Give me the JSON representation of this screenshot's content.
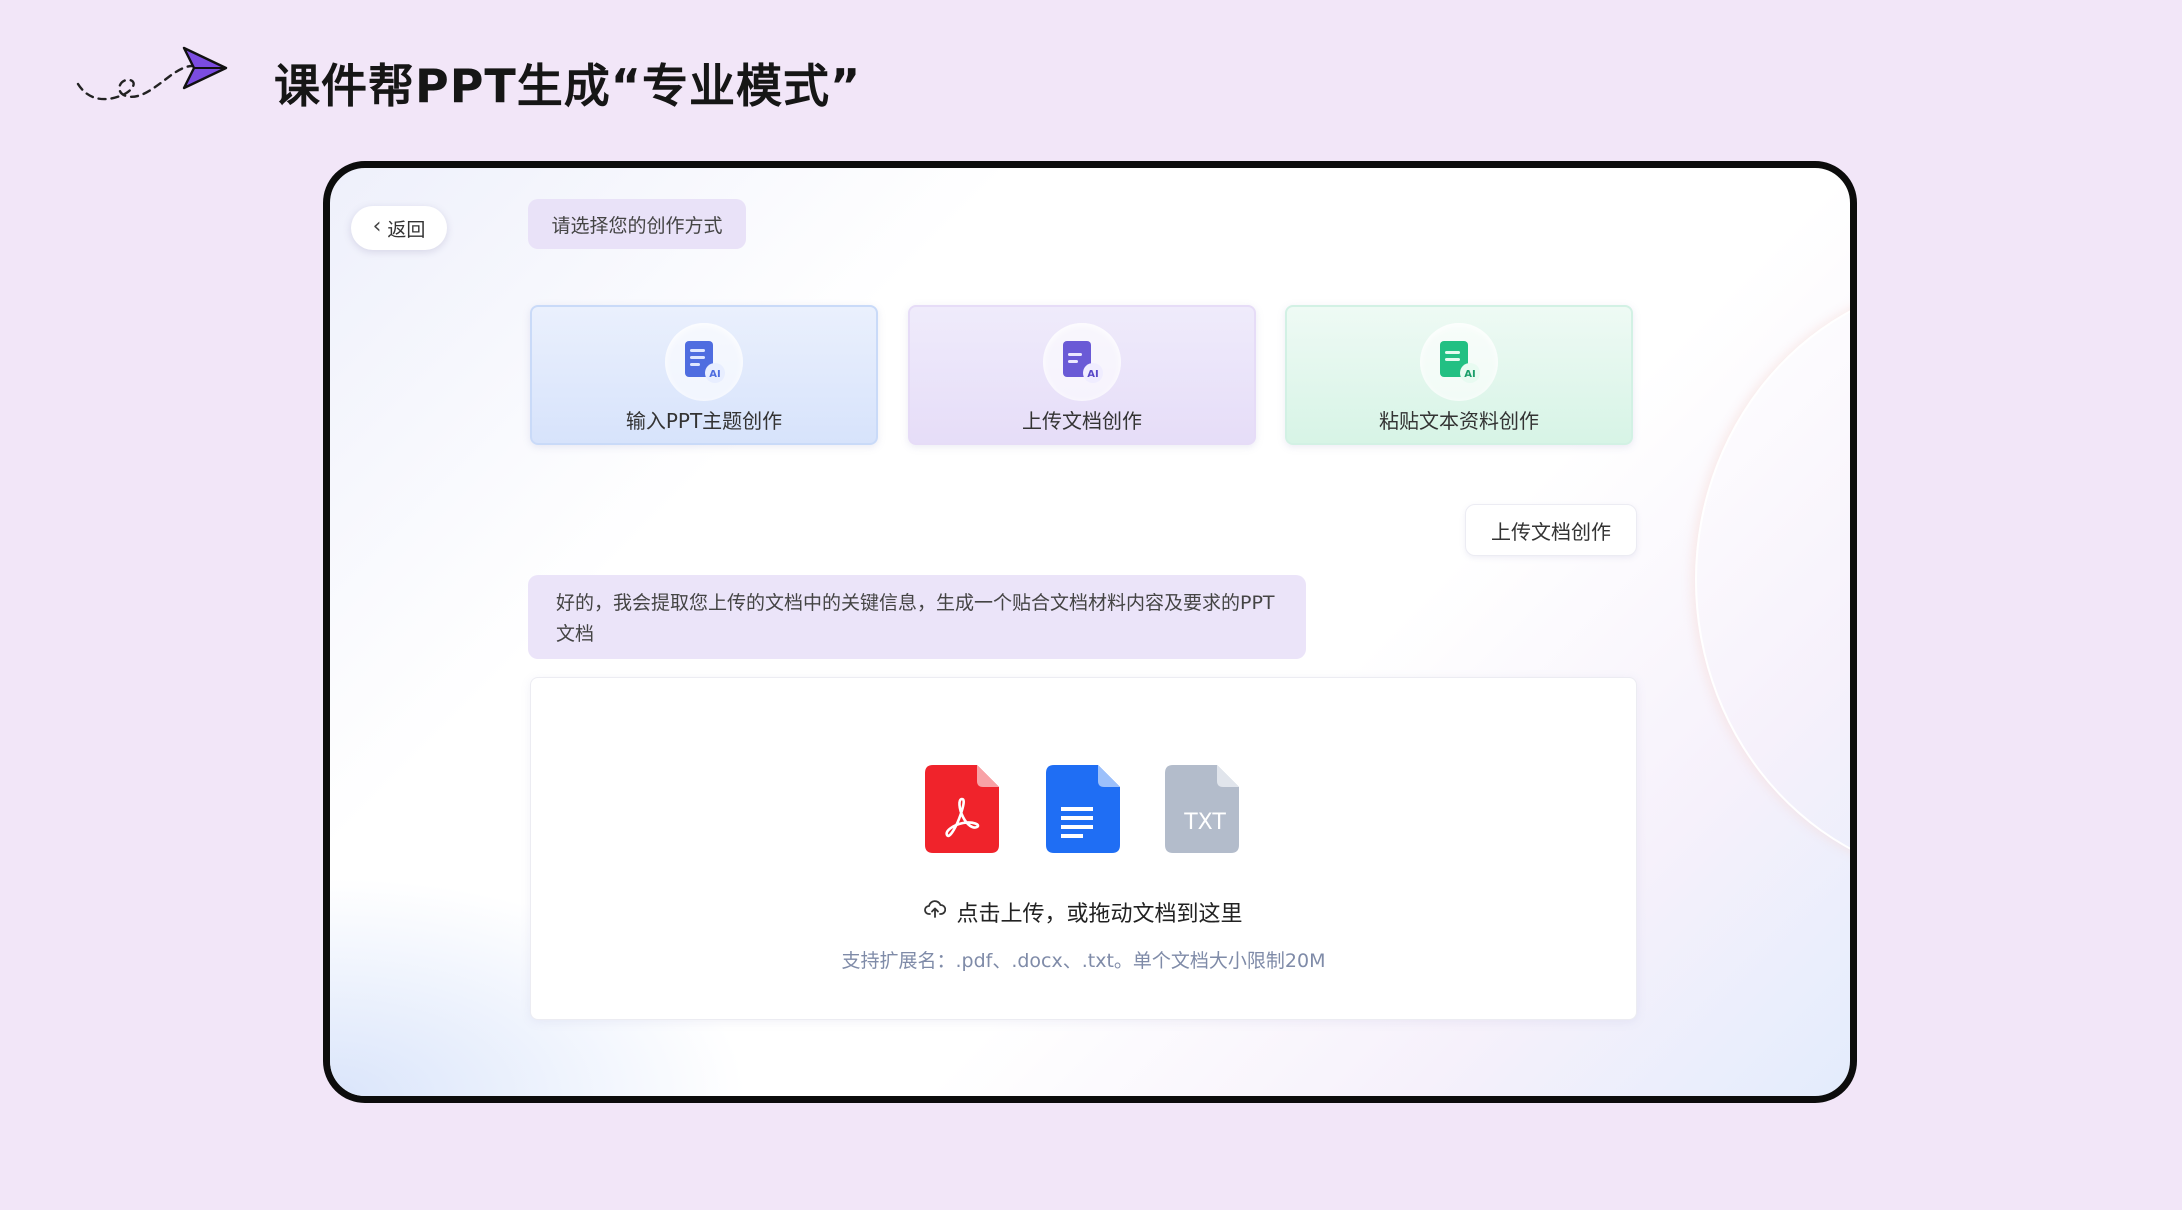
{
  "page_title": "课件帮PPT生成“专业模式”",
  "app": {
    "back_label": "返回",
    "prompt": "请选择您的创作方式",
    "modes": [
      {
        "label": "输入PPT主题创作",
        "icon": "topic-doc-icon",
        "color": "#4f6de0"
      },
      {
        "label": "上传文档创作",
        "icon": "upload-doc-icon",
        "color": "#6a5ad6"
      },
      {
        "label": "粘贴文本资料创作",
        "icon": "paste-doc-icon",
        "color": "#22c083"
      }
    ],
    "ai_badge": "AI",
    "user_message": "上传文档创作",
    "bot_message": "好的，我会提取您上传的文档中的关键信息，生成一个贴合文档材料内容及要求的PPT文档",
    "upload": {
      "file_types": [
        {
          "name": "pdf",
          "icon": "pdf-file-icon",
          "color": "#f0232b"
        },
        {
          "name": "docx",
          "icon": "word-doc-icon",
          "color": "#1f6ef4"
        },
        {
          "name": "txt",
          "icon": "txt-file-icon",
          "color": "#b3bccb",
          "text": "TXT"
        }
      ],
      "hint": "点击上传，或拖动文档到这里",
      "formats": "支持扩展名：.pdf、.docx、.txt。单个文档大小限制20M"
    }
  }
}
